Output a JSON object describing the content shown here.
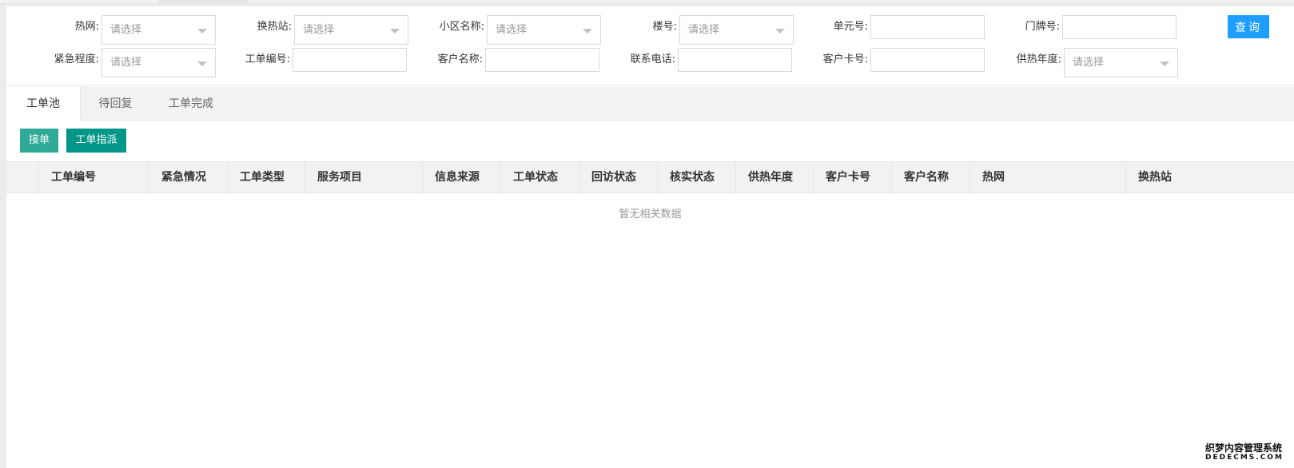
{
  "filters": {
    "heat_network": {
      "label": "热网:",
      "placeholder": "请选择"
    },
    "exchange_station": {
      "label": "换热站:",
      "placeholder": "请选择"
    },
    "community": {
      "label": "小区名称:",
      "placeholder": "请选择"
    },
    "building": {
      "label": "楼号:",
      "placeholder": "请选择"
    },
    "unit": {
      "label": "单元号:",
      "value": ""
    },
    "door": {
      "label": "门牌号:",
      "value": ""
    },
    "urgency": {
      "label": "紧急程度:",
      "placeholder": "请选择"
    },
    "order_no": {
      "label": "工单编号:",
      "value": ""
    },
    "customer_name": {
      "label": "客户名称:",
      "value": ""
    },
    "phone": {
      "label": "联系电话:",
      "value": ""
    },
    "card_no": {
      "label": "客户卡号:",
      "value": ""
    },
    "heat_year": {
      "label": "供热年度:",
      "placeholder": "请选择"
    },
    "query_button": "查询"
  },
  "tabs": [
    {
      "label": "工单池",
      "active": true
    },
    {
      "label": "待回复",
      "active": false
    },
    {
      "label": "工单完成",
      "active": false
    }
  ],
  "toolbar": {
    "accept": "接单",
    "assign": "工单指派"
  },
  "table": {
    "columns": [
      "工单编号",
      "紧急情况",
      "工单类型",
      "服务项目",
      "信息来源",
      "工单状态",
      "回访状态",
      "核实状态",
      "供热年度",
      "客户卡号",
      "客户名称",
      "热网",
      "换热站"
    ],
    "empty_text": "暂无相关数据"
  },
  "watermark": {
    "line1": "织梦内容管理系统",
    "line2": "DEDECMS.COM"
  },
  "colors": {
    "primary": "#1e9fff",
    "accept": "#2eaa97",
    "assign": "#009688"
  }
}
